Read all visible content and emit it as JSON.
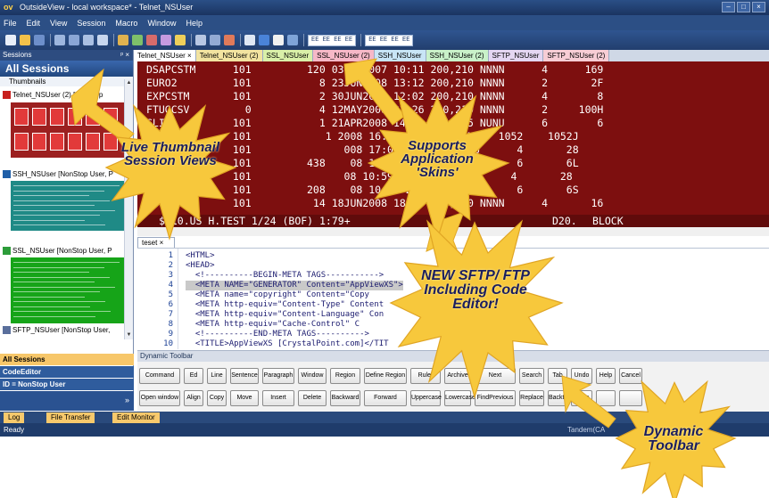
{
  "window": {
    "app_icon": "ov",
    "title": "OutsideView - local workspace* - Telnet_NSUser"
  },
  "menu": [
    "File",
    "Edit",
    "View",
    "Session",
    "Macro",
    "Window",
    "Help"
  ],
  "toolbar": {
    "text_buttons": [
      "EE EE EE EE",
      "EE EE EE EE"
    ]
  },
  "sessions": {
    "header": "Sessions",
    "close_glyph": "ᵖ ×",
    "title": "All Sessions",
    "view_mode": "Thumbnails",
    "items": [
      {
        "label": "Telnet_NSUser (2) [NonStop"
      },
      {
        "label": "SSH_NSUser [NonStop User, P"
      },
      {
        "label": "SSL_NSUser [NonStop User, P"
      },
      {
        "label": "SFTP_NSUser [NonStop User,"
      }
    ]
  },
  "navigation": {
    "items": [
      "All Sessions",
      "CodeEditor",
      "ID = NonStop User"
    ]
  },
  "terminal": {
    "tabs": [
      {
        "label": "Telnet_NSUser",
        "close": "×",
        "color": "#ffffff"
      },
      {
        "label": "Telnet_NSUser (2)",
        "close": "",
        "color": "#f2e3a0"
      },
      {
        "label": "SSL_NSUser",
        "close": "",
        "color": "#d9f0a8"
      },
      {
        "label": "SSL_NSUser (2)",
        "close": "",
        "color": "#f6b8c7"
      },
      {
        "label": "SSH_NSUser",
        "close": "",
        "color": "#c8e5f6"
      },
      {
        "label": "SSH_NSUser (2)",
        "close": "",
        "color": "#c9f1c9"
      },
      {
        "label": "SFTP_NSUser",
        "close": "",
        "color": "#e4d6f2"
      },
      {
        "label": "SFTP_NSUser (2)",
        "close": "",
        "color": "#f7cdd5"
      }
    ],
    "rows": [
      "DSAPCSTM      101         120 03OCT2007 10:11 200,210 NNNN      4      169",
      "EURO2         101           8 23JUN2008 13:12 200,210 NNNN      2       2F",
      "EXPCSTM       101           2 30JUN2008 12:02 200,210 NNNN      4        8",
      "FTUGCSV         0           4 12MAY2008 22:26 200,210 NNNN      2     100H",
      "GLIN          101           1 21APR2008 14:19 255,255 NUNU      6        6",
      "              101            1 2008 16:31 200,210 NNNN   1052    1052J",
      "              101               008 17:08 255,255 NUNU      4       28",
      "              101         438    08 13:10 200,210 NNNN      6       6L",
      "              101               08 10:59 255,255 NUNU      4       28",
      "              101         208    08 10:42 255,255 NUNU      6       6S",
      "              101          14 18JUN2008 18:57 200,210 NNNN      4       16"
    ],
    "status_line": "$ 10.US H.TEST 1/24 (BOF) 1:79+",
    "status_code": "D20.",
    "status_mode": "BLOCK"
  },
  "editor": {
    "tab_label": "teset",
    "tab_close": "×",
    "lines": [
      {
        "n": "1",
        "text": "<HTML>",
        "hl": false
      },
      {
        "n": "2",
        "text": "<HEAD>",
        "hl": false
      },
      {
        "n": "3",
        "text": "  <!----------BEGIN-META TAGS----------->",
        "hl": false
      },
      {
        "n": "4",
        "text": "  <META NAME=\"GENERATOR\" Content=\"AppViewXS\">",
        "hl": true
      },
      {
        "n": "5",
        "text": "  <META name=\"copyright\" Content=\"Copy                    m, Inc.\">",
        "hl": false
      },
      {
        "n": "6",
        "text": "  <META http-equiv=\"Content-Type\" Content",
        "hl": false
      },
      {
        "n": "7",
        "text": "  <META http-equiv=\"Content-Language\" Con",
        "hl": false
      },
      {
        "n": "8",
        "text": "  <META http-equiv=\"Cache-Control\" C",
        "hl": false
      },
      {
        "n": "9",
        "text": "  <!----------END-META TAGS---------->",
        "hl": false
      },
      {
        "n": "10",
        "text": "  <TITLE>AppViewXS [CrystalPoint.com]</TIT",
        "hl": false
      }
    ]
  },
  "dynamic_toolbar": {
    "title": "Dynamic Toolbar",
    "row1": [
      "Command",
      "Ed",
      "Line",
      "Sentence",
      "Paragraph",
      "Window",
      "Region",
      "Define Region",
      "Ruler",
      "Archive",
      "Next",
      "Search",
      "Tab",
      "Undo",
      "Help",
      "Cancel"
    ],
    "row2": [
      "Open window",
      "Align",
      "Copy",
      "Move",
      "Insert",
      "Delete",
      "Backward",
      "Forward",
      "Uppercase",
      "Lowercase",
      "FindPrevious",
      "Replace",
      "Backtab",
      "Redo",
      "",
      ""
    ]
  },
  "bottom_tabs": [
    "Log",
    "File Transfer",
    "Edit Monitor"
  ],
  "status": {
    "left": "Ready",
    "right": "Tandem(CA"
  },
  "callouts": {
    "thumbnails": "Live Thumbnail Session Views",
    "skins": "Supports Application 'Skins'",
    "sftp": "NEW SFTP/ FTP Including Code Editor!",
    "dyntoolbar": "Dynamic Toolbar"
  },
  "colors": {
    "terminal_bg": "#7d0f0f",
    "burst_fill": "#f7c83c",
    "title_bar": "#1f3c6b",
    "accent_orange": "#f7c96c"
  }
}
